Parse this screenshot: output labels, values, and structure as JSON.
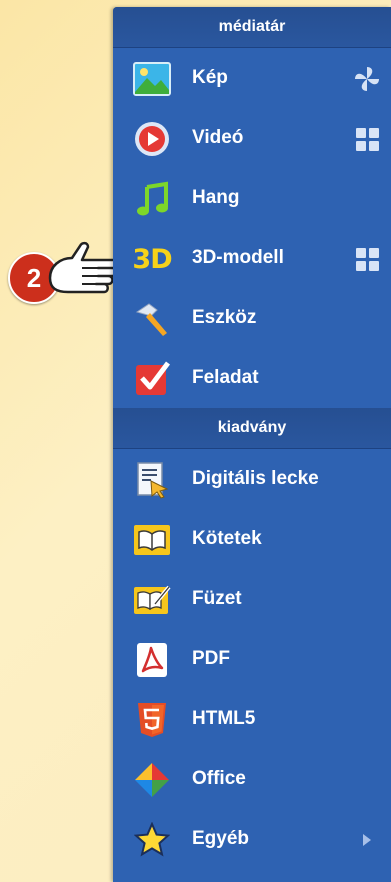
{
  "sections": {
    "media": {
      "title": "médiatár",
      "items": [
        {
          "label": "Kép",
          "icon": "image-icon",
          "right": "pinwheel-icon"
        },
        {
          "label": "Videó",
          "icon": "play-icon",
          "right": "grid-icon"
        },
        {
          "label": "Hang",
          "icon": "music-note-icon"
        },
        {
          "label": "3D-modell",
          "icon": "3d-icon",
          "right": "grid-icon"
        },
        {
          "label": "Eszköz",
          "icon": "hammer-icon"
        },
        {
          "label": "Feladat",
          "icon": "checkmark-task-icon"
        }
      ]
    },
    "publication": {
      "title": "kiadvány",
      "items": [
        {
          "label": "Digitális lecke",
          "icon": "digital-lesson-icon"
        },
        {
          "label": "Kötetek",
          "icon": "open-book-icon"
        },
        {
          "label": "Füzet",
          "icon": "workbook-icon"
        },
        {
          "label": "PDF",
          "icon": "pdf-icon"
        },
        {
          "label": "HTML5",
          "icon": "html5-icon"
        },
        {
          "label": "Office",
          "icon": "office-icon"
        },
        {
          "label": "Egyéb",
          "icon": "star-icon",
          "right": "submenu-arrow-icon"
        }
      ]
    }
  },
  "callout": {
    "number": "2",
    "text_3d": "3D"
  },
  "colors": {
    "menu_bg": "#2e62b2",
    "header_bg": "#264f92",
    "badge": "#cc2f1c"
  }
}
